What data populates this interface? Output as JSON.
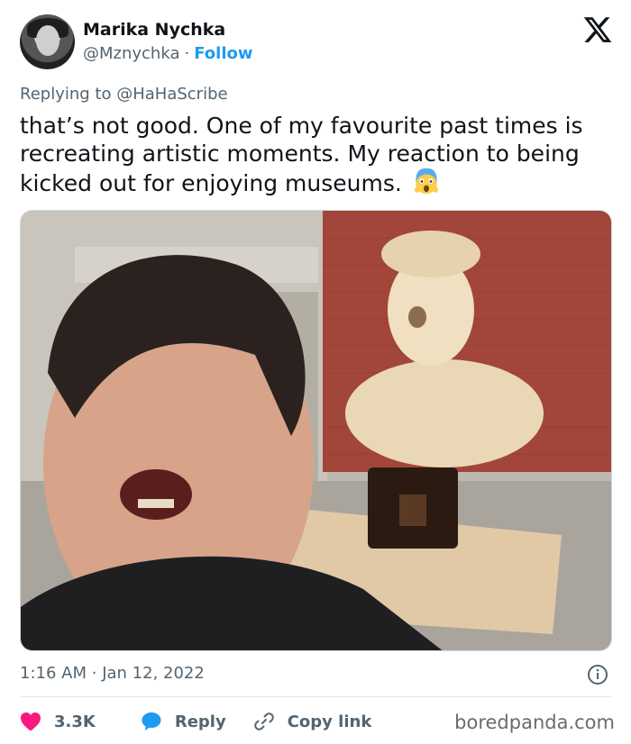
{
  "author": {
    "name": "Marika Nychka",
    "handle": "@Mznychka",
    "separator": "·",
    "follow_label": "Follow"
  },
  "tweet": {
    "replying_prefix": "Replying to",
    "replying_to": "@HaHaScribe",
    "text": "that’s not good. One of my favourite past times is recreating artistic moments. My reaction to being kicked out for enjoying museums.",
    "emoji": "scream-emoji",
    "time": "1:16 AM",
    "date_separator": "·",
    "date": "Jan 12, 2022"
  },
  "actions": {
    "likes": "3.3K",
    "reply_label": "Reply",
    "copy_label": "Copy link"
  },
  "watermark": "boredpanda.com",
  "icons": {
    "logo": "x-logo-icon",
    "info": "info-icon",
    "like": "heart-icon",
    "reply": "speech-bubble-icon",
    "copy": "link-icon"
  },
  "colors": {
    "text": "#0f1419",
    "secondary": "#536471",
    "link": "#1d9bf0",
    "like": "#f91880",
    "reply": "#1d9bf0"
  }
}
